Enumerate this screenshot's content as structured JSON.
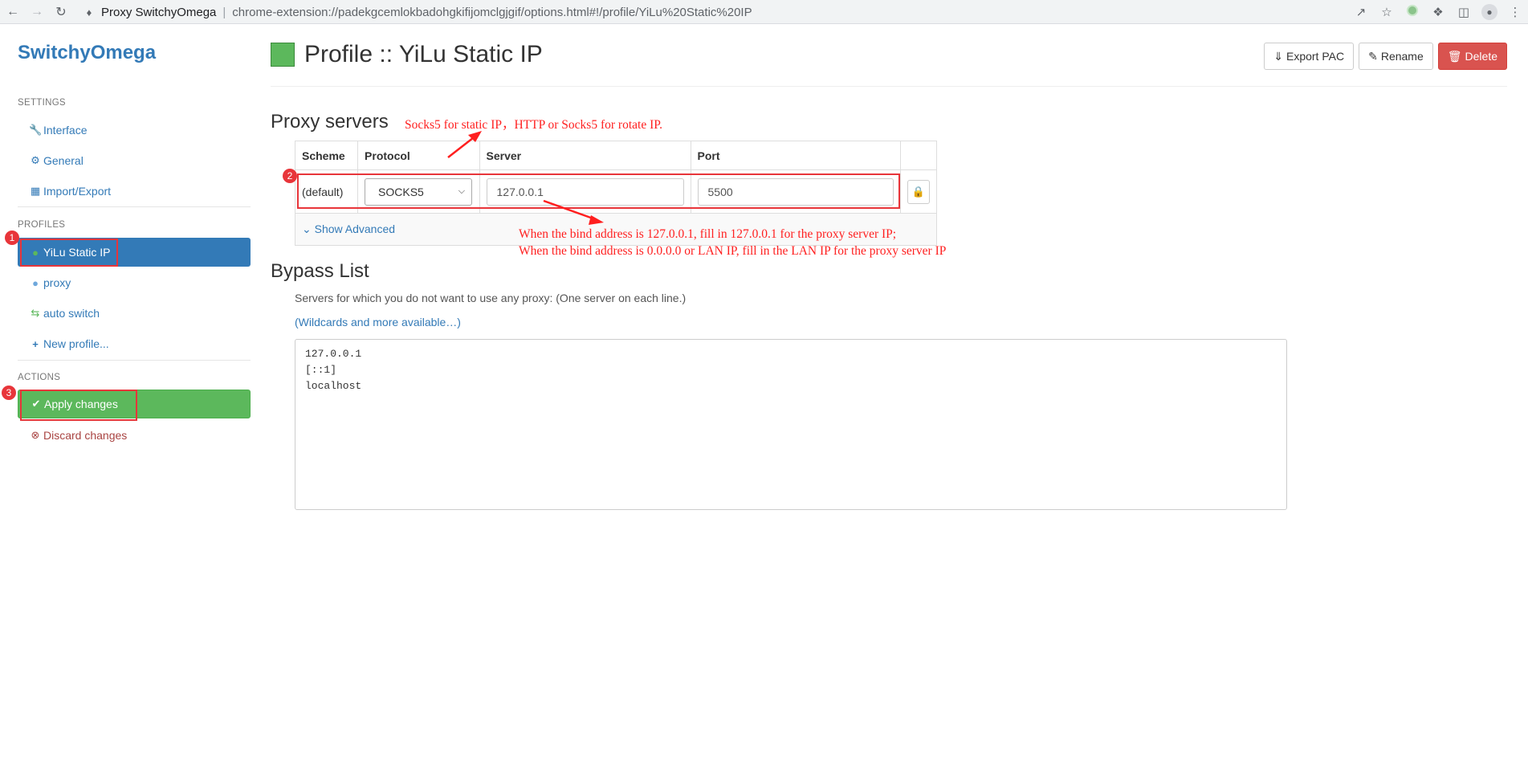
{
  "browser": {
    "site_name": "Proxy SwitchyOmega",
    "url": "chrome-extension://padekgcemlokbadohgkifijomclgjgif/options.html#!/profile/YiLu%20Static%20IP"
  },
  "sidebar": {
    "brand": "SwitchyOmega",
    "settings_header": "SETTINGS",
    "settings_items": [
      {
        "label": "Interface",
        "icon": "wrench-icon"
      },
      {
        "label": "General",
        "icon": "gear-icon"
      },
      {
        "label": "Import/Export",
        "icon": "sitemap-icon"
      }
    ],
    "profiles_header": "PROFILES",
    "profiles": [
      {
        "label": "YiLu Static IP",
        "icon": "globe-icon",
        "active": true
      },
      {
        "label": "proxy",
        "icon": "globe-icon"
      },
      {
        "label": "auto switch",
        "icon": "switch-icon"
      },
      {
        "label": "New profile...",
        "icon": "plus-icon"
      }
    ],
    "actions_header": "ACTIONS",
    "apply_label": "Apply changes",
    "discard_label": "Discard changes"
  },
  "header": {
    "title": "Profile :: YiLu Static IP",
    "swatch_color": "#5cb85c",
    "export_label": "Export PAC",
    "rename_label": "Rename",
    "delete_label": "Delete"
  },
  "proxy": {
    "section_title": "Proxy servers",
    "columns": [
      "Scheme",
      "Protocol",
      "Server",
      "Port"
    ],
    "row": {
      "scheme": "(default)",
      "protocol": "SOCKS5",
      "server": "127.0.0.1",
      "port": "5500"
    },
    "show_advanced": "Show Advanced"
  },
  "bypass": {
    "section_title": "Bypass List",
    "help": "Servers for which you do not want to use any proxy: (One server on each line.)",
    "wildcards_link": "(Wildcards and more available…)",
    "entries": [
      "127.0.0.1",
      "[::1]",
      "localhost"
    ]
  },
  "annotations": {
    "protocol_note": "Socks5 for static IP，HTTP or Socks5 for rotate IP.",
    "server_note_1": "When the bind address is 127.0.0.1, fill in 127.0.0.1 for the proxy server IP;",
    "server_note_2": "When the bind address is 0.0.0.0 or LAN IP, fill in the LAN IP for the proxy server IP",
    "badges": [
      "1",
      "2",
      "3"
    ],
    "color": "#ff1f1f"
  }
}
